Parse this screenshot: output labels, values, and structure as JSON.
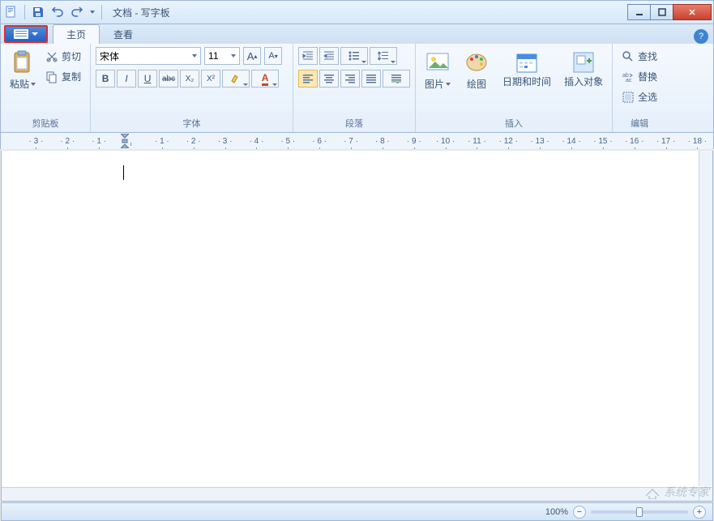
{
  "title": "文档 - 写字板",
  "tabs": {
    "home": "主页",
    "view": "查看"
  },
  "clipboard": {
    "paste": "粘贴",
    "cut": "剪切",
    "copy": "复制",
    "group": "剪贴板"
  },
  "font": {
    "name": "宋体",
    "size": "11",
    "grow": "A",
    "shrink": "A",
    "bold": "B",
    "italic": "I",
    "underline": "U",
    "strike": "abc",
    "subscript": "X₂",
    "superscript": "X²",
    "group": "字体"
  },
  "paragraph": {
    "group": "段落"
  },
  "insert": {
    "picture": "图片",
    "paint": "绘图",
    "datetime": "日期和时间",
    "object": "插入对象",
    "group": "插入"
  },
  "edit": {
    "find": "查找",
    "replace": "替换",
    "selectall": "全选",
    "group": "编辑"
  },
  "ruler": [
    "3",
    "2",
    "1",
    "",
    "1",
    "2",
    "3",
    "4",
    "5",
    "6",
    "7",
    "8",
    "9",
    "10",
    "11",
    "12",
    "13",
    "14",
    "15",
    "16",
    "17",
    "18"
  ],
  "status": {
    "zoom": "100%"
  },
  "watermark": "系统专家"
}
